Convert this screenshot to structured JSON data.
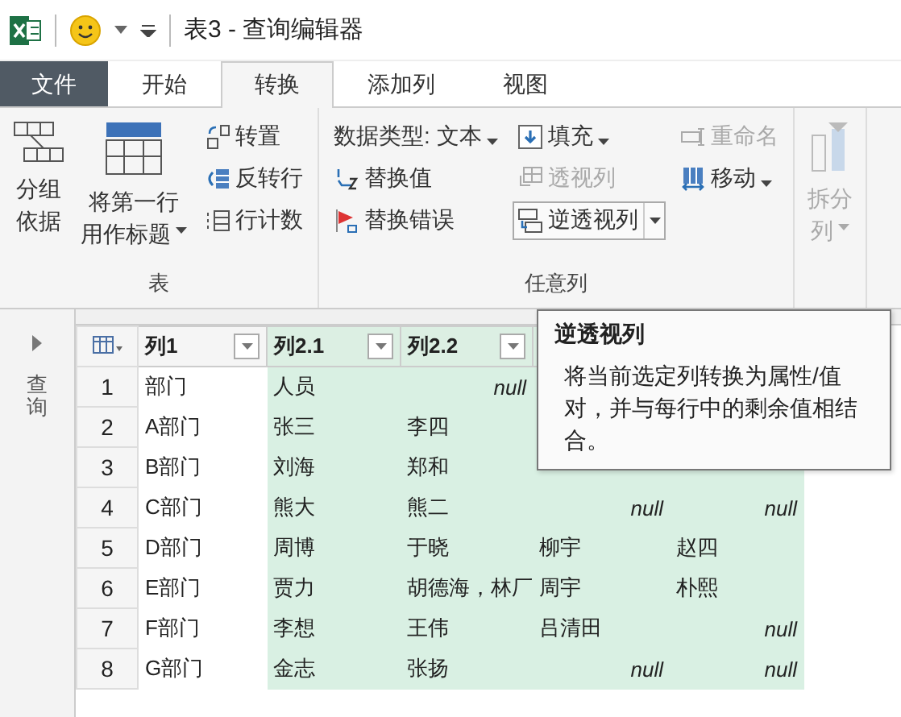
{
  "title_bar": {
    "title": "表3 - 查询编辑器"
  },
  "tabs": [
    {
      "label": "文件",
      "kind": "file",
      "selected": false
    },
    {
      "label": "开始",
      "kind": "tab",
      "selected": false
    },
    {
      "label": "转换",
      "kind": "tab",
      "selected": true
    },
    {
      "label": "添加列",
      "kind": "tab",
      "selected": false
    },
    {
      "label": "视图",
      "kind": "tab",
      "selected": false
    }
  ],
  "ribbon": {
    "groups": [
      {
        "label": "表",
        "large": [
          {
            "lines": [
              "分组",
              "依据"
            ],
            "dropdown": false,
            "disabled": false
          },
          {
            "lines": [
              "将第一行",
              "用作标题"
            ],
            "dropdown": true,
            "disabled": false
          }
        ],
        "columns": [
          [
            {
              "label": "转置",
              "dropdown": false,
              "disabled": false,
              "highlighted": false
            },
            {
              "label": "反转行",
              "dropdown": false,
              "disabled": false,
              "highlighted": false
            },
            {
              "label": "行计数",
              "dropdown": false,
              "disabled": false,
              "highlighted": false
            }
          ]
        ]
      },
      {
        "label": "任意列",
        "columns": [
          [
            {
              "label": "数据类型: 文本",
              "dropdown": true,
              "disabled": false,
              "highlighted": false
            },
            {
              "label": "替换值",
              "dropdown": false,
              "disabled": false,
              "highlighted": false
            },
            {
              "label": "替换错误",
              "dropdown": false,
              "disabled": false,
              "highlighted": false
            }
          ],
          [
            {
              "label": "填充",
              "dropdown": true,
              "disabled": false,
              "highlighted": false
            },
            {
              "label": "透视列",
              "dropdown": false,
              "disabled": true,
              "highlighted": false
            },
            {
              "label": "逆透视列",
              "dropdown": true,
              "disabled": false,
              "highlighted": true
            }
          ],
          [
            {
              "label": "重命名",
              "dropdown": false,
              "disabled": true,
              "highlighted": false
            },
            {
              "label": "移动",
              "dropdown": true,
              "disabled": false,
              "highlighted": false
            }
          ]
        ]
      },
      {
        "large": [
          {
            "lines": [
              "拆分",
              "列"
            ],
            "dropdown": true,
            "disabled": true
          }
        ]
      }
    ]
  },
  "side_panel": {
    "label": "查询",
    "expanded": false
  },
  "grid": {
    "columns": [
      {
        "label": "列1",
        "selected": false
      },
      {
        "label": "列2.1",
        "selected": true
      },
      {
        "label": "列2.2",
        "selected": true
      },
      {
        "selected": true
      },
      {
        "selected": true
      }
    ],
    "rows": [
      {
        "number": "1",
        "cells": [
          {
            "kind": "text",
            "text": "部门"
          },
          {
            "kind": "text",
            "text": "人员"
          },
          {
            "kind": "null",
            "text": "null"
          },
          {
            "kind": "covered"
          },
          {
            "kind": "covered"
          }
        ]
      },
      {
        "number": "2",
        "cells": [
          {
            "kind": "text",
            "text": "A部门"
          },
          {
            "kind": "text",
            "text": "张三"
          },
          {
            "kind": "text",
            "text": "李四"
          },
          {
            "kind": "covered"
          },
          {
            "kind": "covered"
          }
        ]
      },
      {
        "number": "3",
        "cells": [
          {
            "kind": "text",
            "text": "B部门"
          },
          {
            "kind": "text",
            "text": "刘海"
          },
          {
            "kind": "text",
            "text": "郑和"
          },
          {
            "kind": "covered"
          },
          {
            "kind": "covered"
          }
        ]
      },
      {
        "number": "4",
        "cells": [
          {
            "kind": "text",
            "text": "C部门"
          },
          {
            "kind": "text",
            "text": "熊大"
          },
          {
            "kind": "text",
            "text": "熊二"
          },
          {
            "kind": "null",
            "text": "null"
          },
          {
            "kind": "null",
            "text": "null"
          }
        ]
      },
      {
        "number": "5",
        "cells": [
          {
            "kind": "text",
            "text": "D部门"
          },
          {
            "kind": "text",
            "text": "周博"
          },
          {
            "kind": "text",
            "text": "于晓"
          },
          {
            "kind": "text",
            "text": "柳宇"
          },
          {
            "kind": "text",
            "text": "赵四"
          }
        ]
      },
      {
        "number": "6",
        "cells": [
          {
            "kind": "text",
            "text": "E部门"
          },
          {
            "kind": "text",
            "text": "贾力"
          },
          {
            "kind": "text",
            "text": "胡德海，林厂"
          },
          {
            "kind": "text",
            "text": "周宇"
          },
          {
            "kind": "text",
            "text": "朴熙"
          }
        ]
      },
      {
        "number": "7",
        "cells": [
          {
            "kind": "text",
            "text": "F部门"
          },
          {
            "kind": "text",
            "text": "李想"
          },
          {
            "kind": "text",
            "text": "王伟"
          },
          {
            "kind": "text",
            "text": "吕清田"
          },
          {
            "kind": "null",
            "text": "null"
          }
        ]
      },
      {
        "number": "8",
        "cells": [
          {
            "kind": "text",
            "text": "G部门"
          },
          {
            "kind": "text",
            "text": "金志"
          },
          {
            "kind": "text",
            "text": "张扬"
          },
          {
            "kind": "null",
            "text": "null"
          },
          {
            "kind": "null",
            "text": "null"
          }
        ]
      }
    ]
  },
  "tooltip": {
    "title": "逆透视列",
    "text": "将当前选定列转换为属性/值对，并与每行中的剩余值相结合。"
  }
}
